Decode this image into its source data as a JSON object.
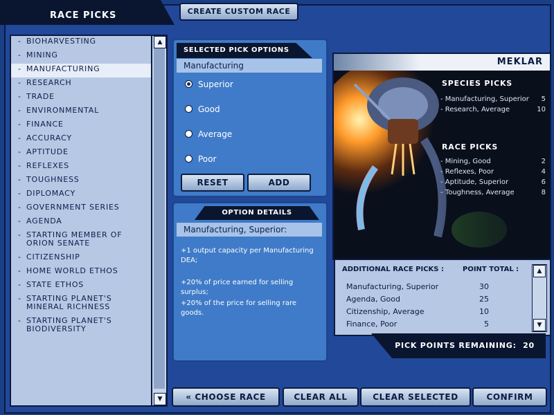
{
  "header": {
    "title": "RACE PICKS",
    "create_button": "CREATE CUSTOM RACE"
  },
  "race_list": {
    "items": [
      "BIOHARVESTING",
      "MINING",
      "MANUFACTURING",
      "RESEARCH",
      "TRADE",
      "ENVIRONMENTAL",
      "FINANCE",
      "ACCURACY",
      "APTITUDE",
      "REFLEXES",
      "TOUGHNESS",
      "DIPLOMACY",
      "GOVERNMENT SERIES",
      "AGENDA",
      "STARTING MEMBER OF ORION SENATE",
      "CITIZENSHIP",
      "HOME WORLD ETHOS",
      "STATE ETHOS",
      "STARTING PLANET'S MINERAL RICHNESS",
      "STARTING PLANET'S BIODIVERSITY"
    ],
    "selected": "MANUFACTURING"
  },
  "selected_pick": {
    "heading": "SELECTED PICK OPTIONS",
    "pick_name": "Manufacturing",
    "options": [
      "Superior",
      "Good",
      "Average",
      "Poor"
    ],
    "selected_option": "Superior",
    "reset_label": "RESET",
    "add_label": "ADD"
  },
  "option_details": {
    "heading": "OPTION DETAILS",
    "title": "Manufacturing, Superior:",
    "lines": [
      "+1 output capacity per Manufacturing DEA;",
      "+20% of price earned for selling surplus;",
      "+20% of the price for selling rare goods."
    ]
  },
  "race": {
    "name": "MEKLAR",
    "species_heading": "SPECIES PICKS",
    "species_picks": [
      {
        "label": "- Manufacturing, Superior",
        "value": "5"
      },
      {
        "label": "- Research, Average",
        "value": "10"
      }
    ],
    "race_heading": "RACE PICKS",
    "race_picks": [
      {
        "label": "- Mining, Good",
        "value": "2"
      },
      {
        "label": "- Reflexes, Poor",
        "value": "4"
      },
      {
        "label": "- Aptitude, Superior",
        "value": "6"
      },
      {
        "label": "- Toughness, Average",
        "value": "8"
      }
    ]
  },
  "additional": {
    "col1": "ADDITIONAL RACE PICKS :",
    "col2": "POINT TOTAL :",
    "rows": [
      {
        "label": "Manufacturing, Superior",
        "value": "30"
      },
      {
        "label": "Agenda, Good",
        "value": "25"
      },
      {
        "label": "Citizenship, Average",
        "value": "10"
      },
      {
        "label": "Finance, Poor",
        "value": "5"
      }
    ],
    "remaining_label": "PICK POINTS REMAINING:",
    "remaining_value": "20"
  },
  "footer": {
    "choose_race": "« CHOOSE RACE",
    "clear_all": "CLEAR ALL",
    "clear_selected": "CLEAR SELECTED",
    "confirm": "CONFIRM"
  },
  "colors": {
    "frame": "#22489a",
    "panel": "#3f7bc8",
    "list_bg": "#b6c8e4",
    "dark": "#0a1530"
  },
  "icons": {
    "scroll_up": "up-arrow-icon",
    "scroll_down": "down-arrow-icon"
  }
}
